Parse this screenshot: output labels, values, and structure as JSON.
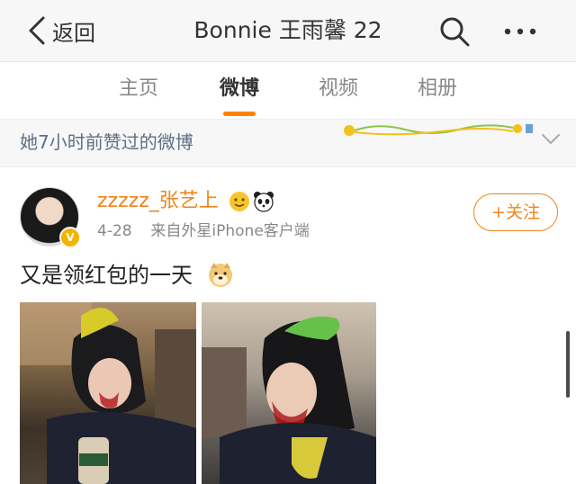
{
  "nav": {
    "back_label": "返回",
    "title": "Bonnie 王雨馨 22"
  },
  "tabs": [
    "主页",
    "微博",
    "视频",
    "相册"
  ],
  "active_tab": "微博",
  "liked_bar": {
    "text": "她7小时前赞过的微博"
  },
  "post": {
    "username": "zzzzz_张艺上",
    "date": "4-28",
    "source": "来自外星iPhone客户端",
    "follow_label": "+关注",
    "text": "又是领红包的一天"
  },
  "colors": {
    "accent": "#f08418",
    "tab_underline": "#ff8200",
    "liked_text": "#5f6f85"
  },
  "icons": {
    "back": "chevron-left-icon",
    "search": "search-icon",
    "more": "more-dots-icon",
    "collapse": "chevron-down-icon"
  }
}
